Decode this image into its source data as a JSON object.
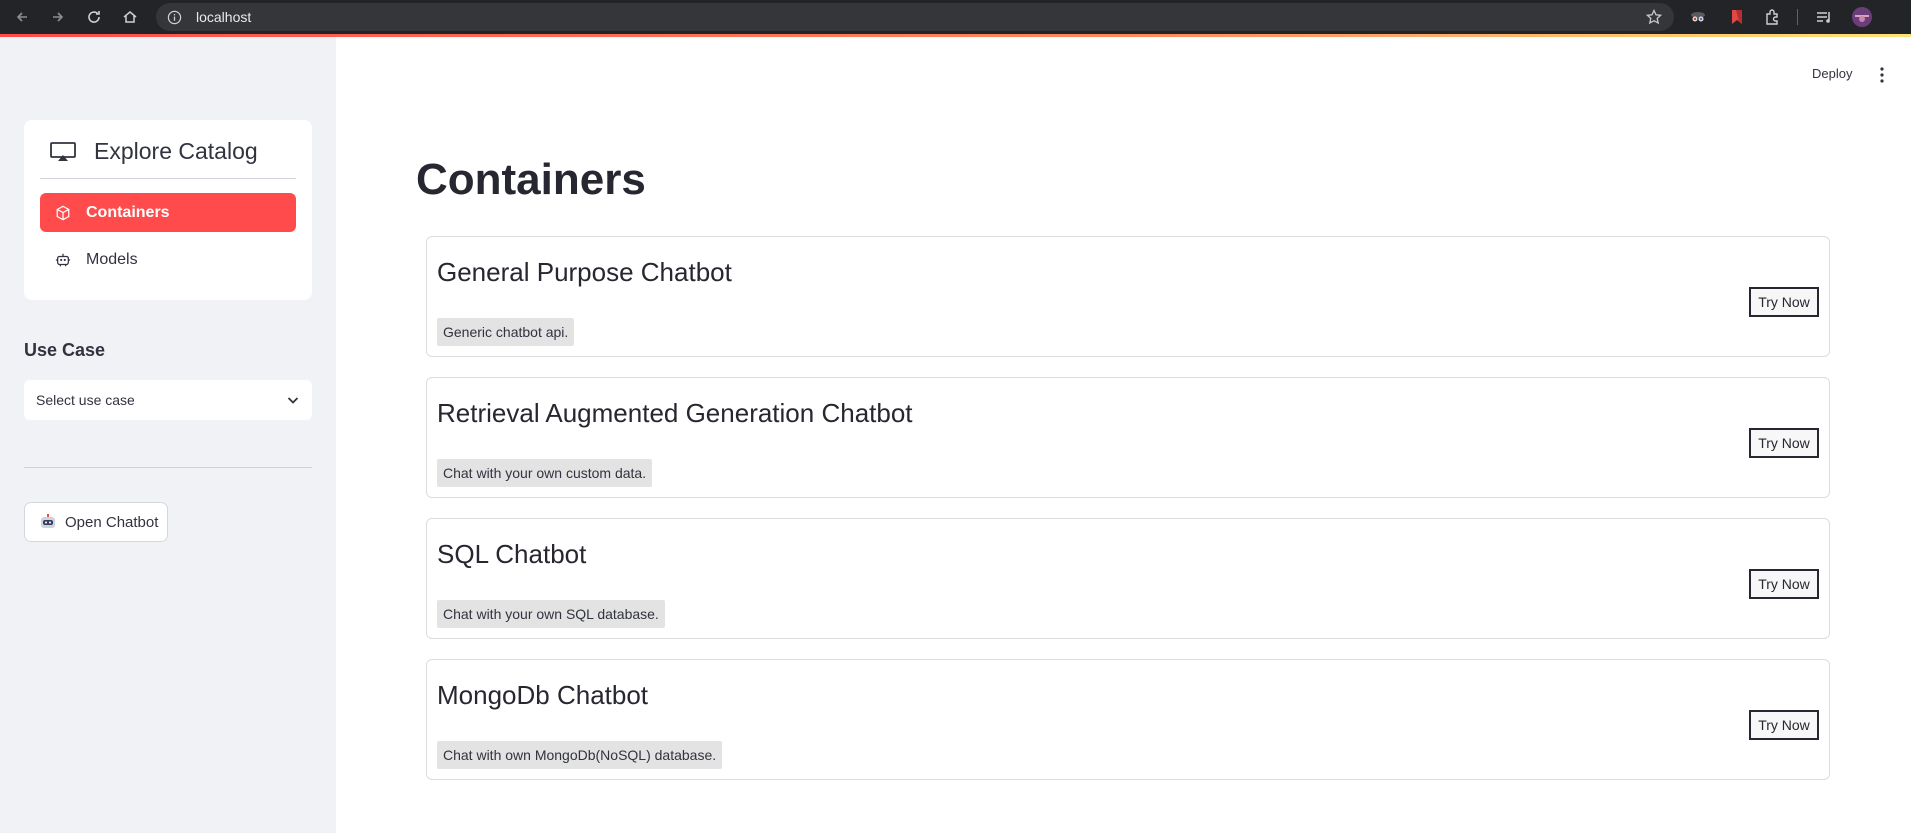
{
  "browser": {
    "url": "localhost"
  },
  "sidebar": {
    "catalog_title": "Explore Catalog",
    "menu": [
      {
        "label": "Containers",
        "icon": "box-icon",
        "active": true
      },
      {
        "label": "Models",
        "icon": "robot-icon",
        "active": false
      }
    ],
    "use_case_label": "Use Case",
    "use_case_placeholder": "Select use case",
    "open_chatbot_label": "Open Chatbot"
  },
  "header": {
    "deploy_label": "Deploy"
  },
  "main": {
    "title": "Containers",
    "cards": [
      {
        "title": "General Purpose Chatbot",
        "description": "Generic chatbot api.",
        "button": "Try Now"
      },
      {
        "title": "Retrieval Augmented Generation Chatbot",
        "description": "Chat with your own custom data.",
        "button": "Try Now"
      },
      {
        "title": "SQL Chatbot",
        "description": "Chat with your own SQL database.",
        "button": "Try Now"
      },
      {
        "title": "MongoDb Chatbot",
        "description": "Chat with own MongoDb(NoSQL) database.",
        "button": "Try Now"
      }
    ]
  },
  "colors": {
    "accent": "#ff4b4b",
    "sidebar_bg": "#f0f2f6",
    "chrome_bg": "#232428"
  }
}
